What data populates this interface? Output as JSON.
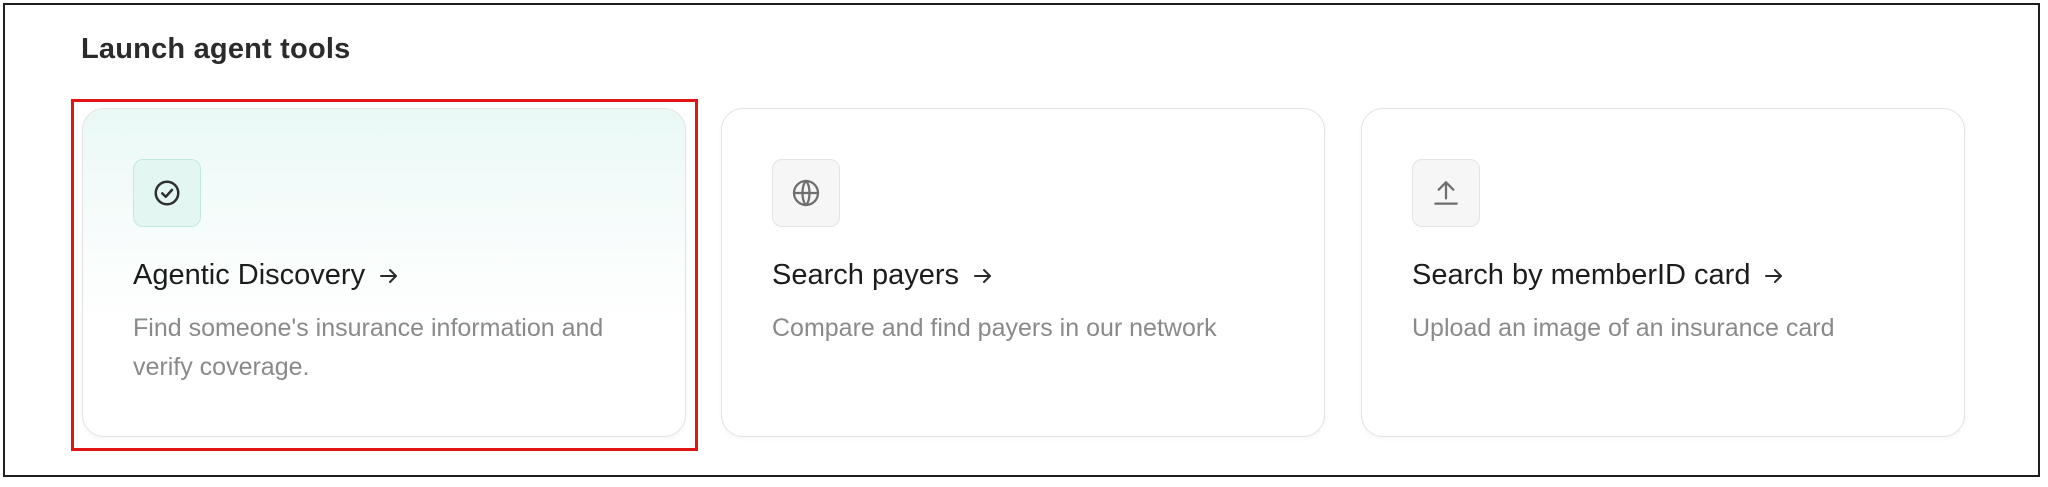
{
  "section": {
    "title": "Launch agent tools"
  },
  "cards": [
    {
      "title": "Agentic Discovery",
      "description": "Find someone's insurance information and verify coverage.",
      "icon": "check-circle-icon",
      "highlighted": true
    },
    {
      "title": "Search payers",
      "description": "Compare and find payers in our network",
      "icon": "globe-icon",
      "highlighted": false
    },
    {
      "title": "Search by memberID card",
      "description": "Upload an image of an insurance card",
      "icon": "upload-icon",
      "highlighted": false
    }
  ],
  "colors": {
    "highlight_border": "#e01515",
    "active_card_tint": "#eaf9f6",
    "active_icon_bg": "#e3f6f1"
  }
}
